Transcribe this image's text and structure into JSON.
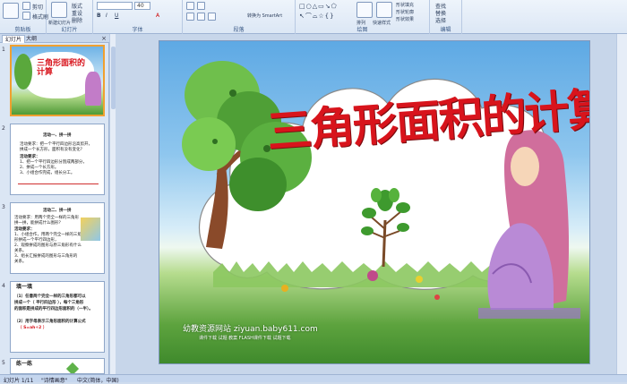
{
  "ribbon": {
    "groups": [
      {
        "label": "剪贴板",
        "items": [
          "粘贴",
          "剪切",
          "格式刷"
        ]
      },
      {
        "label": "幻灯片",
        "items": [
          "新建幻灯片",
          "版式",
          "重设",
          "删除"
        ]
      },
      {
        "label": "字体",
        "items": [
          "40"
        ]
      },
      {
        "label": "段落",
        "items": [
          "转换为 SmartArt"
        ]
      },
      {
        "label": "绘图",
        "items": [
          "排列",
          "快速样式",
          "形状填充",
          "形状轮廓",
          "形状效果"
        ]
      },
      {
        "label": "编辑",
        "items": [
          "查找",
          "替换",
          "选择"
        ]
      }
    ],
    "font_size": "40"
  },
  "panel": {
    "tabs": [
      "幻灯片",
      "大纲"
    ],
    "slide_numbers": [
      "1",
      "2",
      "3",
      "4",
      "5"
    ],
    "thumb1": {
      "title": "三角形面积的计算"
    },
    "thumb2": {
      "lines": [
        "活动一、拼一拼",
        "活动要求：把一个平行四边形沿高剪开，",
        "拼成一个长方形，面积有没有变化？",
        "活动要求：",
        "1、把一个平行四边形分割成两部分，",
        "2、拼成一个长方形。",
        "3、小组合作完成，组长分工。"
      ]
    },
    "thumb3": {
      "lines": [
        "活动二、拼一拼",
        "活动要求：用两个完全一样的三角形",
        "拼一拼，能拼成什么图形？",
        "活动要求：",
        "1、小组合作，用两个完全一样的三角",
        "形拼成一个平行四边形，",
        "2、观察拼成的图形与原三角形有什么",
        "关系。",
        "3、组长汇报拼成的图形与三角形的",
        "关系。"
      ]
    },
    "thumb4": {
      "title": "填一填",
      "lines": [
        "（1）任意两个完全一样的三角形都可以",
        "拼成一个（ 平行四边形 ），每个三角形",
        "的面积是拼成的平行四边形面积的（一半）。",
        "（2）用字母表示三角形面积的计算公式",
        "（ S=ah÷2 ）"
      ]
    },
    "thumb5": {
      "title": "练一练"
    }
  },
  "slide": {
    "title": "三角形面积的计算",
    "watermark_line1": "幼教资源网站  ziyuan.baby611.com",
    "watermark_line2": "课件下载  试题  教案  FLASH课件下载  试题下载"
  },
  "status": {
    "slide_pos": "幻灯片 1/11",
    "theme": "\"诗情画意\"",
    "language": "中文(简体，中国)"
  },
  "colors": {
    "title_red": "#d8141c",
    "selection": "#f0a030",
    "ribbon_blue": "#dce7f5"
  }
}
